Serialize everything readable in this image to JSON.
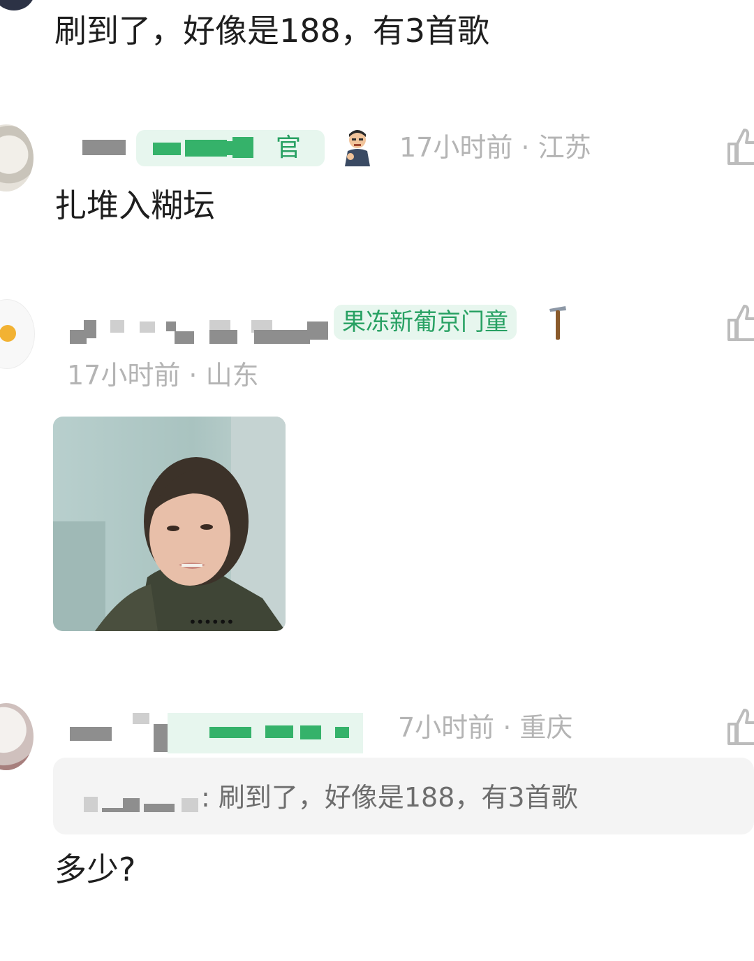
{
  "comments": [
    {
      "text": "刷到了，好像是188，有3首歌"
    },
    {
      "badge": "官",
      "meta": "17小时前 · 江苏",
      "text": "扎堆入糊坛"
    },
    {
      "badge": "果冻新葡京门童",
      "meta": "17小时前 · 山东",
      "image_dots": "••••••"
    },
    {
      "meta": "7小时前 · 重庆",
      "quote": ": 刷到了，好像是188，有3首歌",
      "text": "多少?"
    }
  ],
  "icons": {
    "like": "thumbs-up-icon",
    "hammer": "hammer-icon",
    "avatar_emoji": "angry-man-icon"
  },
  "colors": {
    "badge_bg": "#e7f6ee",
    "badge_text": "#28a163",
    "meta_text": "#b4b4b4"
  }
}
